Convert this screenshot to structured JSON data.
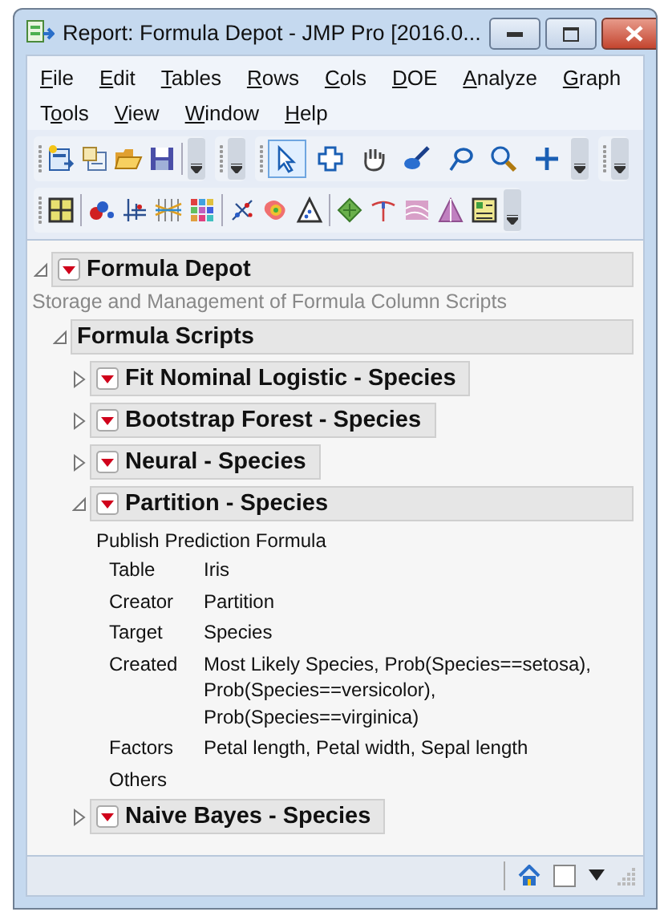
{
  "window": {
    "title": "Report: Formula Depot - JMP Pro [2016.0..."
  },
  "menu_rows": [
    [
      {
        "key": "F",
        "after": "ile"
      },
      {
        "key": "E",
        "after": "dit"
      },
      {
        "key": "T",
        "after": "ables"
      },
      {
        "key": "R",
        "after": "ows"
      },
      {
        "key": "C",
        "after": "ols"
      },
      {
        "key": "D",
        "after": "OE"
      },
      {
        "key": "A",
        "after": "nalyze"
      },
      {
        "key": "G",
        "after": "raph"
      }
    ],
    [
      {
        "before": "T",
        "key": "o",
        "after": "ols"
      },
      {
        "key": "V",
        "after": "iew"
      },
      {
        "key": "W",
        "after": "indow"
      },
      {
        "key": "H",
        "after": "elp"
      }
    ]
  ],
  "tools": [
    {
      "selected": true
    },
    {
      "selected": false
    },
    {
      "selected": false
    },
    {
      "selected": false
    },
    {
      "selected": false
    },
    {
      "selected": false
    },
    {
      "selected": false
    }
  ],
  "report": [
    {
      "kind": "outline",
      "title": "Formula Depot",
      "menu": true,
      "expanded": true,
      "children": [
        {
          "kind": "note",
          "text": "Storage and Management of Formula Column Scripts"
        },
        {
          "kind": "outline",
          "title": "Formula Scripts",
          "menu": false,
          "expanded": true,
          "children": [
            {
              "kind": "outline",
              "title": "Fit Nominal Logistic - Species",
              "menu": true,
              "expanded": false
            },
            {
              "kind": "outline",
              "title": "Bootstrap Forest - Species",
              "menu": true,
              "expanded": false
            },
            {
              "kind": "outline",
              "title": "Neural - Species",
              "menu": true,
              "expanded": false
            },
            {
              "kind": "outline",
              "title": "Partition - Species",
              "menu": true,
              "expanded": true,
              "children": [
                {
                  "kind": "details",
                  "heading": "Publish Prediction Formula",
                  "rows": [
                    {
                      "label": "Table",
                      "value": "Iris"
                    },
                    {
                      "label": "Creator",
                      "value": "Partition"
                    },
                    {
                      "label": "Target",
                      "value": "Species"
                    },
                    {
                      "label": "Created",
                      "value": "Most Likely Species, Prob(Species==setosa), Prob(Species==versicolor), Prob(Species==virginica)"
                    },
                    {
                      "label": "Factors",
                      "value": "Petal length, Petal width, Sepal length"
                    },
                    {
                      "label": "Others"
                    }
                  ]
                }
              ]
            },
            {
              "kind": "outline",
              "title": "Naive Bayes - Species",
              "menu": true,
              "expanded": false
            }
          ]
        }
      ]
    }
  ],
  "status_bar": {
    "checkbox_checked": false
  }
}
